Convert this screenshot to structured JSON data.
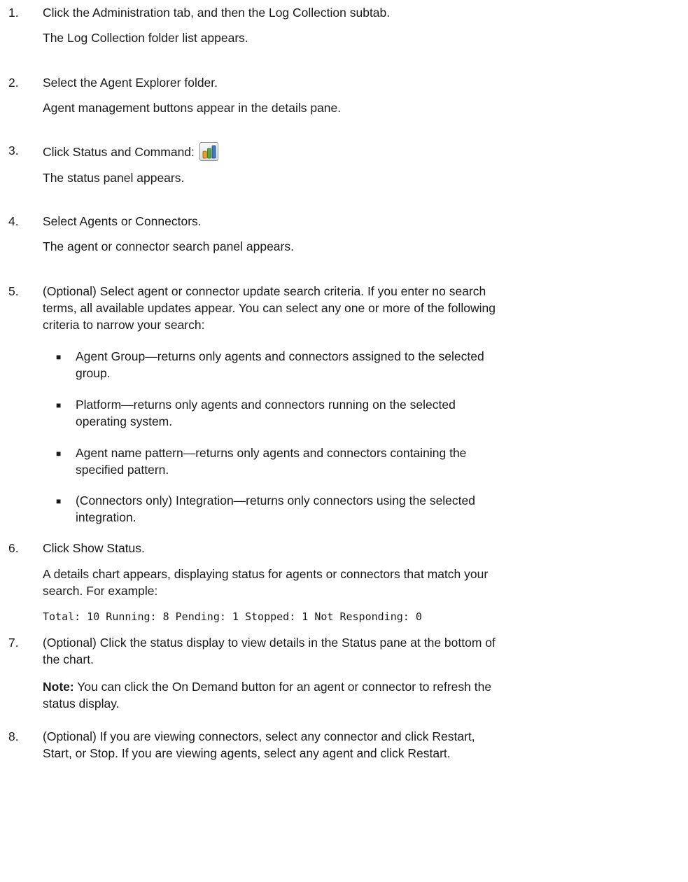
{
  "steps": [
    {
      "num": "1.",
      "text": "Click the Administration tab, and then the Log Collection subtab.",
      "result": "The Log Collection folder list appears."
    },
    {
      "num": "2.",
      "text": "Select the Agent Explorer folder.",
      "result": "Agent management buttons appear in the details pane."
    },
    {
      "num": "3.",
      "text": "Click Status and Command:",
      "icon": "status-and-command-icon",
      "result": "The status panel appears."
    },
    {
      "num": "4.",
      "text": "Select Agents or Connectors.",
      "result": "The agent or connector search panel appears."
    },
    {
      "num": "5.",
      "lines": [
        "(Optional) Select agent or connector update search criteria. If you enter no search",
        "terms, all available updates appear. You can select any one or more of the following",
        "criteria to narrow your search:"
      ]
    },
    {
      "num": "6.",
      "text": "Click Show Status.",
      "result_lines": [
        "A details chart appears, displaying status for agents or connectors that match your",
        "search. For example:"
      ],
      "code": "Total: 10 Running: 8 Pending: 1 Stopped: 1 Not Responding: 0"
    },
    {
      "num": "7.",
      "lines": [
        "(Optional) Click the status display to view details in the Status pane at the bottom of",
        "the chart."
      ],
      "note_label": "Note:",
      "note_lines": [
        " You can click the On Demand button for an agent or connector to refresh the",
        "status display."
      ]
    },
    {
      "num": "8.",
      "lines": [
        "(Optional) If you are viewing connectors, select any connector and click Restart,",
        "Start, or Stop. If you are viewing agents, select any agent and click Restart."
      ]
    }
  ],
  "criteria": [
    {
      "lines": [
        "Agent Group—returns only agents and connectors assigned to the selected",
        "group."
      ]
    },
    {
      "lines": [
        "Platform—returns only agents and connectors running on the selected",
        "operating system."
      ]
    },
    {
      "lines": [
        "Agent name pattern—returns only agents and connectors containing the",
        "specified pattern."
      ]
    },
    {
      "lines": [
        "(Connectors only) Integration—returns only connectors using the selected",
        "integration."
      ]
    }
  ],
  "bullet_char": "■",
  "icon_colors": {
    "orange": "#f0a020",
    "green": "#5aa63a",
    "blue": "#3a78c8"
  }
}
